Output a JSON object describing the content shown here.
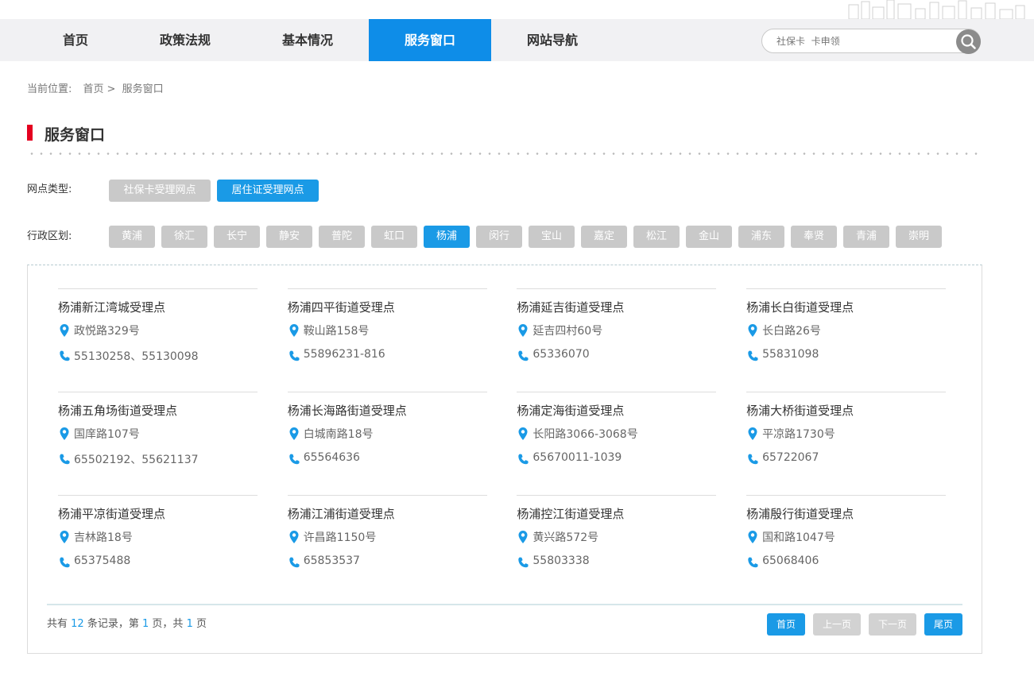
{
  "nav": {
    "items": [
      "首页",
      "政策法规",
      "基本情况",
      "服务窗口",
      "网站导航"
    ],
    "active_index": 3
  },
  "search": {
    "placeholder": "社保卡  卡申领"
  },
  "breadcrumb": {
    "prefix": "当前位置:",
    "home": "首页",
    "sep": ">",
    "current": "服务窗口"
  },
  "page_title": "服务窗口",
  "filters": {
    "type_label": "网点类型:",
    "types": [
      "社保卡受理网点",
      "居住证受理网点"
    ],
    "type_active_index": 1,
    "district_label": "行政区划:",
    "districts": [
      "黄浦",
      "徐汇",
      "长宁",
      "静安",
      "普陀",
      "虹口",
      "杨浦",
      "闵行",
      "宝山",
      "嘉定",
      "松江",
      "金山",
      "浦东",
      "奉贤",
      "青浦",
      "崇明"
    ],
    "district_active_index": 6
  },
  "sites": [
    {
      "name": "杨浦新江湾城受理点",
      "address": "政悦路329号",
      "phone": "55130258、55130098"
    },
    {
      "name": "杨浦四平街道受理点",
      "address": "鞍山路158号",
      "phone": "55896231-816"
    },
    {
      "name": "杨浦延吉街道受理点",
      "address": "延吉四村60号",
      "phone": "65336070"
    },
    {
      "name": "杨浦长白街道受理点",
      "address": "长白路26号",
      "phone": "55831098"
    },
    {
      "name": "杨浦五角场街道受理点",
      "address": "国庠路107号",
      "phone": "65502192、55621137"
    },
    {
      "name": "杨浦长海路街道受理点",
      "address": "白城南路18号",
      "phone": "65564636"
    },
    {
      "name": "杨浦定海街道受理点",
      "address": "长阳路3066-3068号",
      "phone": "65670011-1039"
    },
    {
      "name": "杨浦大桥街道受理点",
      "address": "平凉路1730号",
      "phone": "65722067"
    },
    {
      "name": "杨浦平凉街道受理点",
      "address": "吉林路18号",
      "phone": "65375488"
    },
    {
      "name": "杨浦江浦街道受理点",
      "address": "许昌路1150号",
      "phone": "65853537"
    },
    {
      "name": "杨浦控江街道受理点",
      "address": "黄兴路572号",
      "phone": "55803338"
    },
    {
      "name": "杨浦殷行街道受理点",
      "address": "国和路1047号",
      "phone": "65068406"
    }
  ],
  "pager": {
    "t1": "共有",
    "total": "12",
    "t2": "条记录，第",
    "page": "1",
    "t3": "页，共",
    "pages": "1",
    "t4": "页",
    "first": "首页",
    "prev": "上一页",
    "next": "下一页",
    "last": "尾页"
  },
  "colors": {
    "accent": "#1a9ae6",
    "nav_active": "#0e8de8",
    "title_mark": "#e4001f",
    "inactive": "#c9c9c9"
  },
  "icons": {
    "search": "magnifier-icon",
    "address": "map-pin-icon",
    "phone": "phone-icon"
  }
}
